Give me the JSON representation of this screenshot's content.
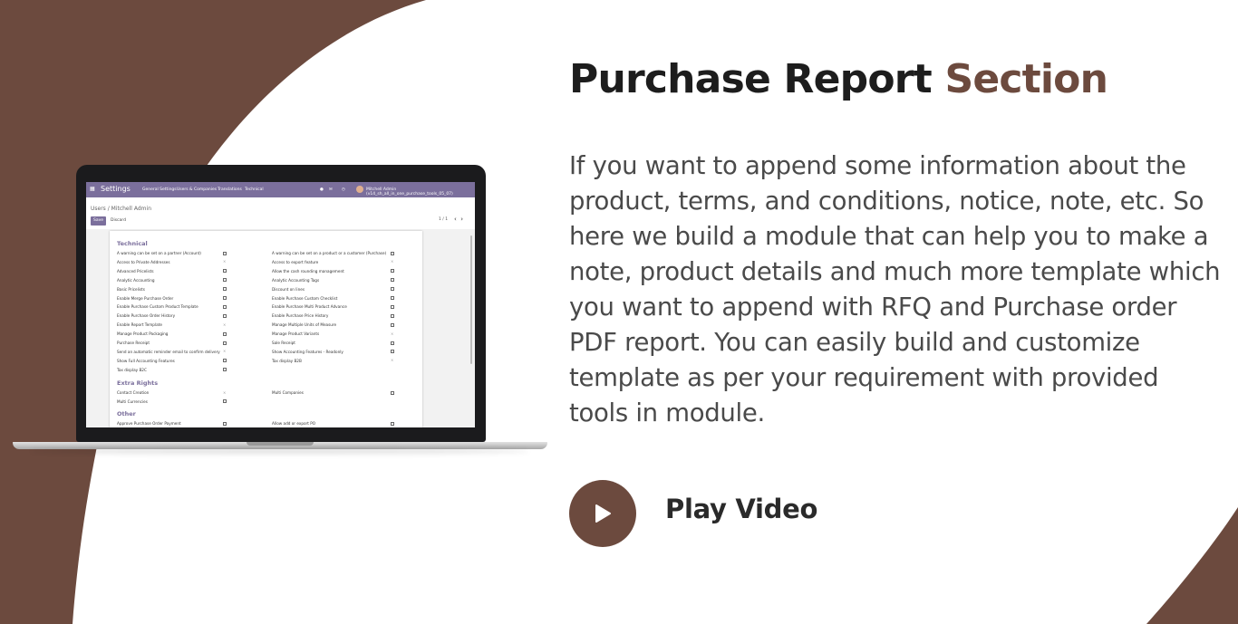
{
  "heading": {
    "main": "Purchase Report",
    "accent": "Section"
  },
  "description": "If you want to append some information about the product, terms, and conditions, notice, note, etc. So here we build a module that can help you to make a note, product details and much more template which you want to append with RFQ and Purchase order PDF report. You can easily build and customize template as per your requirement with provided tools in module.",
  "play_video": {
    "label": "Play Video",
    "icon": "play-icon"
  },
  "colors": {
    "accent": "#6c4a3e",
    "odoo_nav": "#7b6f9c"
  },
  "app": {
    "title": "Settings",
    "menu": [
      "General Settings",
      "Users & Companies",
      "Translations",
      "Technical"
    ],
    "user": "Mitchell Admin (v14_sh_all_in_one_purchase_tools_05_07)",
    "breadcrumb": "Users / Mitchell Admin",
    "save_label": "Save",
    "discard_label": "Discard",
    "pager": "1 / 1",
    "sections": [
      {
        "title": "Technical",
        "left": [
          {
            "label": "A warning can be set on a partner (Account)",
            "state": "unchecked"
          },
          {
            "label": "Access to Private Addresses",
            "state": "x"
          },
          {
            "label": "Advanced Pricelists",
            "state": "unchecked"
          },
          {
            "label": "Analytic Accounting",
            "state": "unchecked"
          },
          {
            "label": "Basic Pricelists",
            "state": "unchecked"
          },
          {
            "label": "Enable Merge Purchase Order",
            "state": "unchecked"
          },
          {
            "label": "Enable Purchase Custom Product Template",
            "state": "unchecked"
          },
          {
            "label": "Enable Purchase Order History",
            "state": "unchecked"
          },
          {
            "label": "Enable Report Template",
            "state": "x"
          },
          {
            "label": "Manage Product Packaging",
            "state": "unchecked"
          },
          {
            "label": "Purchase Receipt",
            "state": "unchecked"
          },
          {
            "label": "Send an automatic reminder email to confirm delivery",
            "state": "x"
          },
          {
            "label": "Show Full Accounting Features",
            "state": "unchecked"
          },
          {
            "label": "Tax display B2C",
            "state": "unchecked"
          }
        ],
        "right": [
          {
            "label": "A warning can be set on a product or a customer (Purchase)",
            "state": "unchecked"
          },
          {
            "label": "Access to export feature",
            "state": "x"
          },
          {
            "label": "Allow the cash rounding management",
            "state": "unchecked"
          },
          {
            "label": "Analytic Accounting Tags",
            "state": "unchecked"
          },
          {
            "label": "Discount on lines",
            "state": "unchecked"
          },
          {
            "label": "Enable Purchase Custom Checklist",
            "state": "unchecked"
          },
          {
            "label": "Enable Purchase Multi Product Advance",
            "state": "unchecked"
          },
          {
            "label": "Enable Purchase Price History",
            "state": "unchecked"
          },
          {
            "label": "Manage Multiple Units of Measure",
            "state": "unchecked"
          },
          {
            "label": "Manage Product Variants",
            "state": "x"
          },
          {
            "label": "Sale Receipt",
            "state": "unchecked"
          },
          {
            "label": "Show Accounting Features - Readonly",
            "state": "unchecked"
          },
          {
            "label": "Tax display B2B",
            "state": "x"
          }
        ]
      },
      {
        "title": "Extra Rights",
        "left": [
          {
            "label": "Contact Creation",
            "state": "x"
          },
          {
            "label": "Multi Currencies",
            "state": "unchecked"
          }
        ],
        "right": [
          {
            "label": "Multi Companies",
            "state": "unchecked"
          }
        ]
      },
      {
        "title": "Other",
        "left": [
          {
            "label": "Approve Purchase Order Payment",
            "state": "unchecked"
          }
        ],
        "right": [
          {
            "label": "Allow add or export PO",
            "state": "unchecked"
          }
        ]
      }
    ]
  }
}
